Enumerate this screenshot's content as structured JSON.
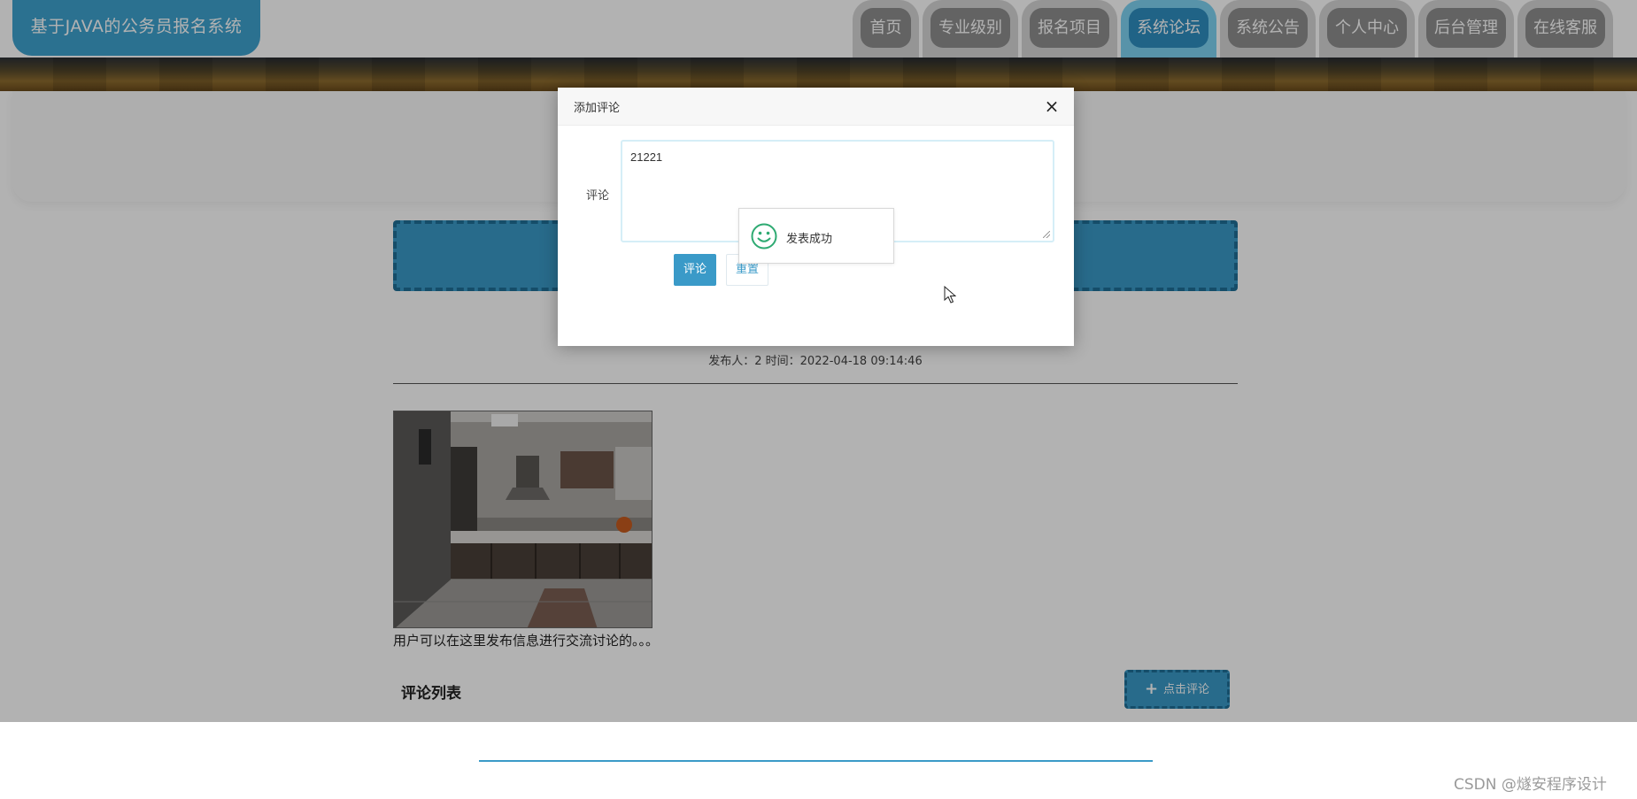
{
  "header": {
    "site_title": "基于JAVA的公务员报名系统",
    "nav": [
      {
        "label": "首页",
        "active": false
      },
      {
        "label": "专业级别",
        "active": false
      },
      {
        "label": "报名项目",
        "active": false
      },
      {
        "label": "系统论坛",
        "active": true
      },
      {
        "label": "系统公告",
        "active": false
      },
      {
        "label": "个人中心",
        "active": false
      },
      {
        "label": "后台管理",
        "active": false
      },
      {
        "label": "在线客服",
        "active": false
      }
    ]
  },
  "post": {
    "meta": "发布人：2 时间：2022-04-18 09:14:46",
    "description": "用户可以在这里发布信息进行交流讨论的。。。",
    "comment_list_title": "评论列表",
    "add_comment_button": "点击评论"
  },
  "modal": {
    "title": "添加评论",
    "close_symbol": "×",
    "comment_label": "评论",
    "comment_value": "21221",
    "submit_label": "评论",
    "reset_label": "重置"
  },
  "toast": {
    "message": "发表成功"
  },
  "footer": {
    "watermark": "CSDN @燧安程序设计"
  },
  "colors": {
    "accent": "#3a9ac8",
    "nav_inactive": "#8e8e8e",
    "nav_active": "#2f8fc1",
    "toast_icon": "#2eaa72"
  },
  "icons": {
    "close": "close-icon",
    "toast": "smiley-success-icon",
    "add": "plus-icon",
    "cursor": "mouse-cursor-icon"
  }
}
